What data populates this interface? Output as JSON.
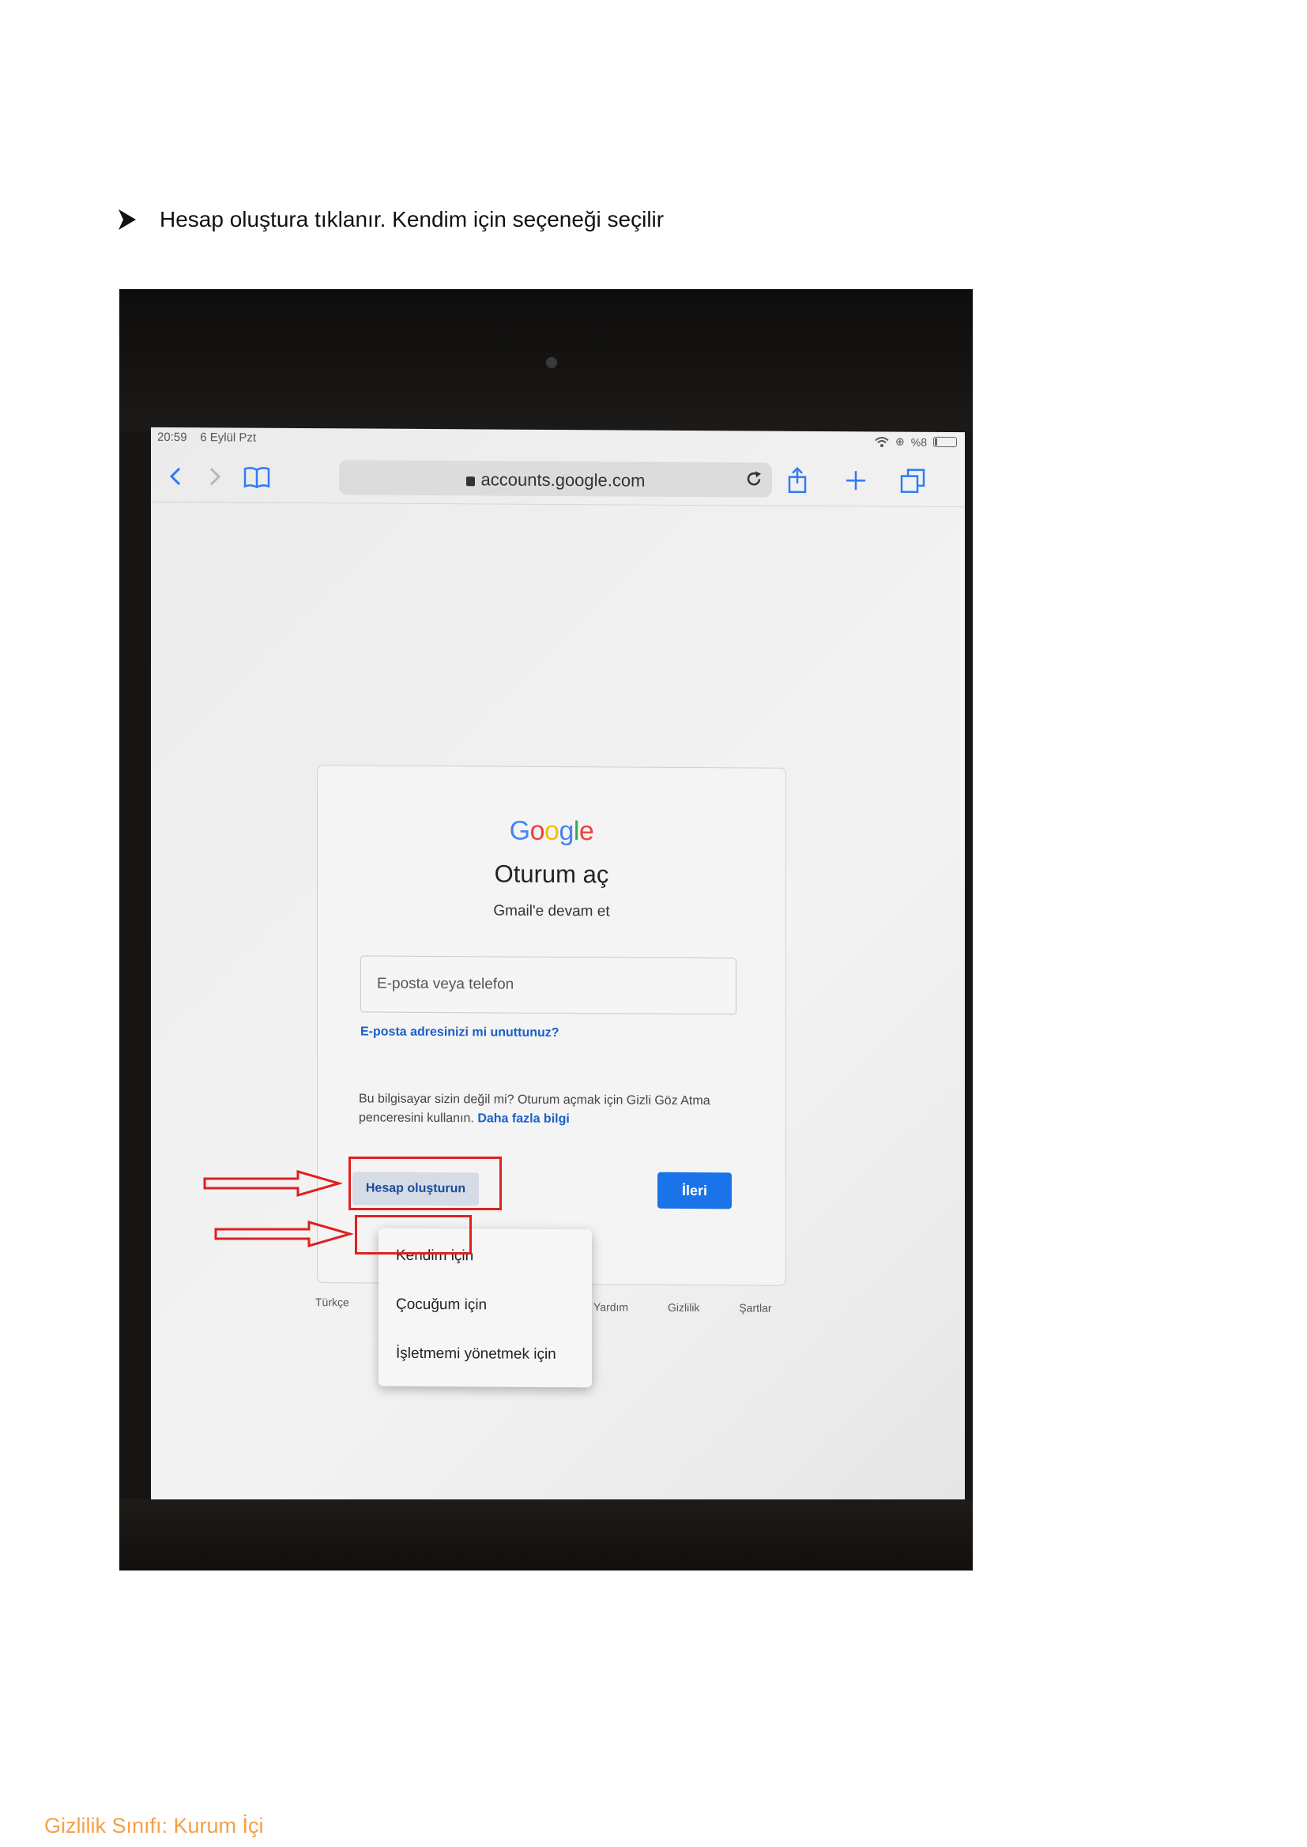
{
  "instruction": {
    "text": "Hesap oluştura tıklanır. Kendim için seçeneği seçilir"
  },
  "device": {
    "status_bar": {
      "time": "20:59",
      "date": "6 Eylül Pzt",
      "battery": "%8"
    },
    "browser": {
      "url": "accounts.google.com"
    }
  },
  "signin": {
    "logo": [
      "G",
      "o",
      "o",
      "g",
      "l",
      "e"
    ],
    "title": "Oturum aç",
    "subtitle": "Gmail'e devam et",
    "email_placeholder": "E-posta veya telefon",
    "forgot_link": "E-posta adresinizi mi unuttunuz?",
    "note_text": "Bu bilgisayar sizin değil mi? Oturum açmak için Gizli Göz Atma penceresini kullanın.",
    "note_link": "Daha fazla bilgi",
    "create_account": "Hesap oluşturun",
    "next": "İleri"
  },
  "create_menu": {
    "items": [
      "Kendim için",
      "Çocuğum için",
      "İşletmemi yönetmek için"
    ]
  },
  "footer": {
    "language": "Türkçe",
    "links": [
      "Yardım",
      "Gizlilik",
      "Şartlar"
    ]
  },
  "colors": {
    "annotation": "#e02020",
    "google_blue": "#4285f4",
    "google_red": "#ea4335",
    "google_yellow": "#fbbc05",
    "google_green": "#34a853",
    "button_blue": "#1a73e8",
    "classification": "#f5a045"
  },
  "classification": "Gizlilik Sınıfı: Kurum İçi"
}
